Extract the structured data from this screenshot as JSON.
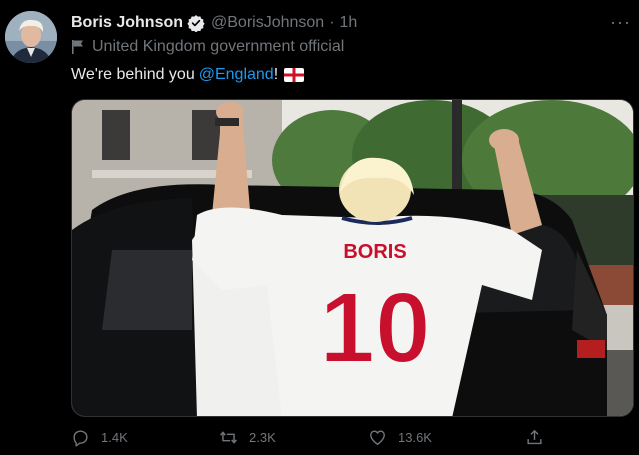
{
  "tweet": {
    "author_name": "Boris Johnson",
    "handle": "@BorisJohnson",
    "separator": "·",
    "time": "1h",
    "label": "United Kingdom government official",
    "text_prefix": "We're behind you",
    "mention": "@England",
    "text_suffix": "!",
    "jersey_name": "BORIS",
    "jersey_number": "10"
  },
  "actions": {
    "replies": "1.4K",
    "retweets": "2.3K",
    "likes": "13.6K"
  },
  "colors": {
    "background": "#000000",
    "primary_text": "#e7e9ea",
    "secondary_text": "#71767b",
    "link": "#1d9bf0",
    "verified": "#1d9bf0"
  },
  "icons": [
    "verified-badge-icon",
    "more-icon",
    "government-flag-icon",
    "england-flag-icon",
    "reply-icon",
    "retweet-icon",
    "like-icon",
    "share-icon"
  ]
}
